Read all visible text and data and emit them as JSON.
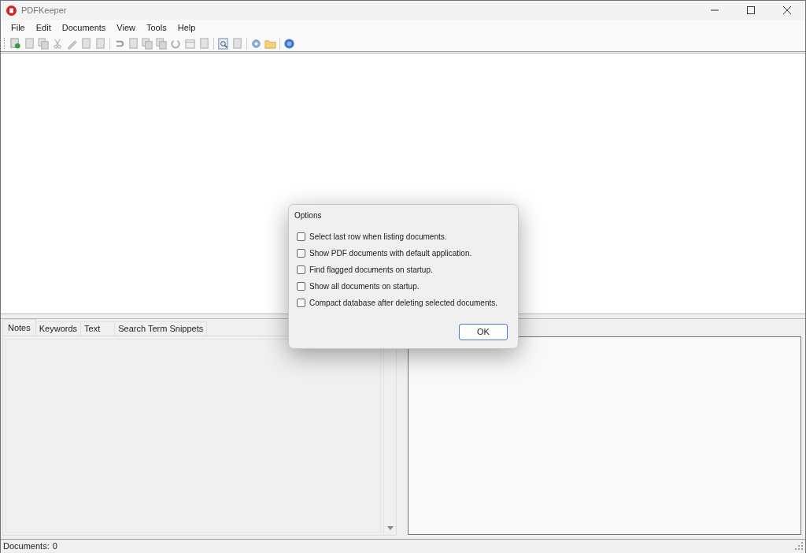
{
  "window": {
    "title": "PDFKeeper"
  },
  "menu": [
    "File",
    "Edit",
    "Documents",
    "View",
    "Tools",
    "Help"
  ],
  "tabs": [
    {
      "label": "Notes",
      "selected": true
    },
    {
      "label": "Keywords",
      "selected": false
    },
    {
      "label": "Text",
      "selected": false
    },
    {
      "label": "Search Term Snippets",
      "selected": false
    }
  ],
  "dialog": {
    "title": "Options",
    "options": [
      {
        "label": "Select last row when listing documents.",
        "checked": false
      },
      {
        "label": "Show PDF documents with default application.",
        "checked": false
      },
      {
        "label": "Find flagged documents on startup.",
        "checked": false
      },
      {
        "label": "Show all documents on startup.",
        "checked": false
      },
      {
        "label": "Compact database after deleting selected documents.",
        "checked": false
      }
    ],
    "button": "OK"
  },
  "status_bar": {
    "label": "Documents:",
    "count": "0"
  }
}
